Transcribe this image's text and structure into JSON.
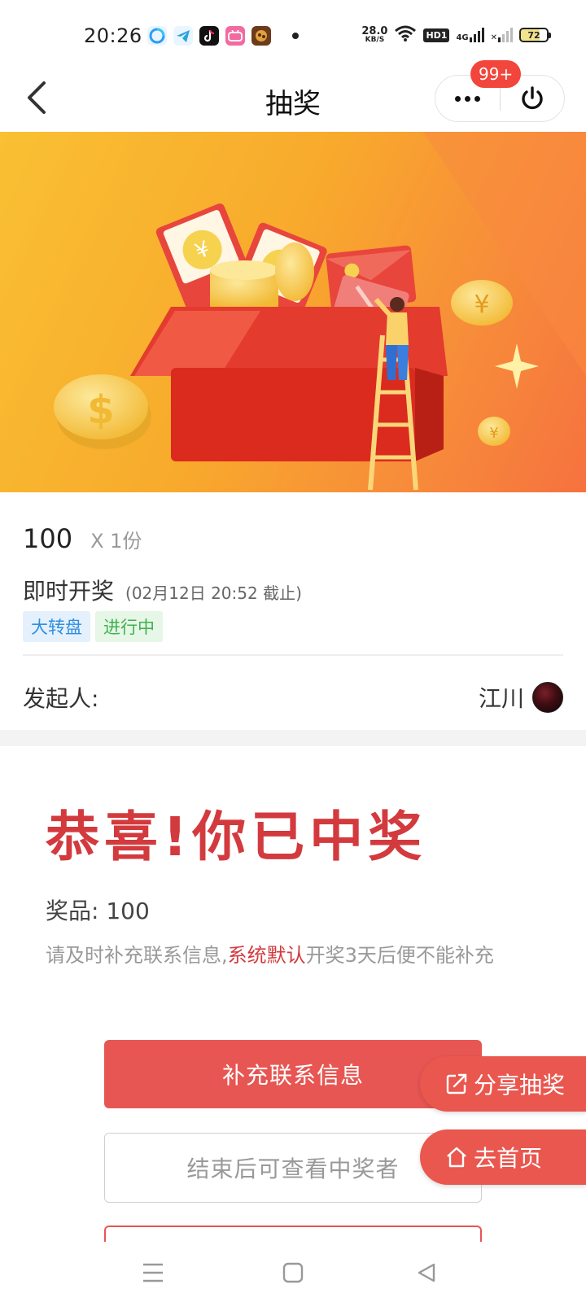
{
  "status_bar": {
    "time": "20:26",
    "network_speed_value": "28.0",
    "network_speed_unit": "KB/S",
    "hd_label": "HD1",
    "signal_label": "4G",
    "battery_level": "72"
  },
  "nav": {
    "title": "抽奖",
    "badge": "99+"
  },
  "lottery": {
    "prize_name": "100",
    "prize_quantity": "X 1份",
    "draw_type": "即时开奖",
    "deadline": "(02月12日 20:52 截止)",
    "tags": [
      "大转盘",
      "进行中"
    ],
    "initiator_label": "发起人:",
    "initiator_name": "江川"
  },
  "result": {
    "title": "恭喜!你已中奖",
    "prize_line": "奖品: 100",
    "notice_before": "请及时补充联系信息,",
    "notice_highlight": "系统默认",
    "notice_after": "开奖3天后便不能补充"
  },
  "buttons": {
    "fill_contact": "补充联系信息",
    "view_winners": "结束后可查看中奖者",
    "share_lottery": "分享抽奖",
    "go_home": "去首页"
  },
  "colors": {
    "accent_red": "#e75652",
    "title_red": "#d33a3e",
    "tag_blue": "#2f8ee0",
    "tag_green": "#3fb24f",
    "badge_red": "#f2453c"
  }
}
